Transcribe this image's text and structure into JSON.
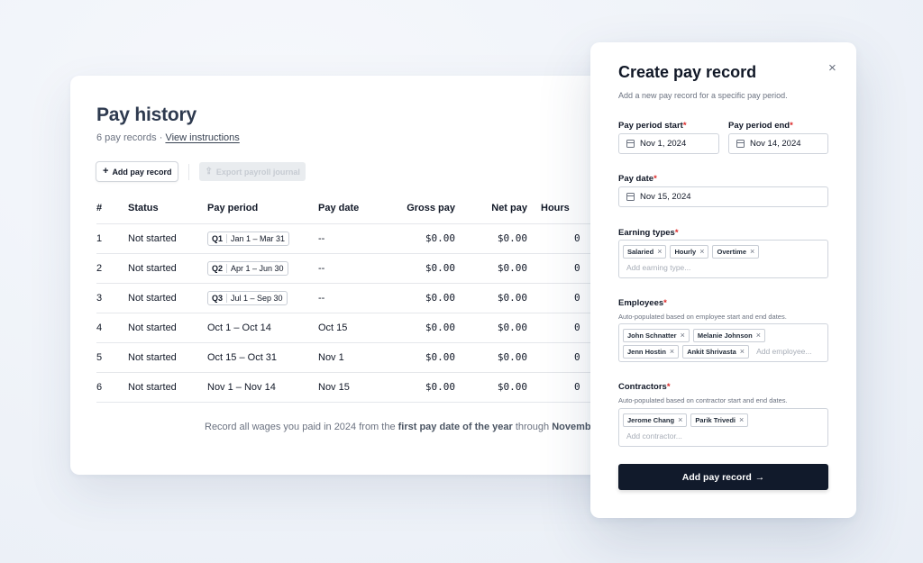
{
  "history": {
    "title": "Pay history",
    "record_count": "6 pay records",
    "separator": "·",
    "instructions_link": "View instructions",
    "add_button": "Add pay record",
    "export_button": "Export payroll journal",
    "columns": [
      "#",
      "Status",
      "Pay period",
      "Pay date",
      "Gross pay",
      "Net pay",
      "Hours"
    ],
    "rows": [
      {
        "num": "1",
        "status": "Not started",
        "quarter": "Q1",
        "period": "Jan 1 – Mar 31",
        "pay_date": "--",
        "gross": "$0.00",
        "net": "$0.00",
        "hours": "0"
      },
      {
        "num": "2",
        "status": "Not started",
        "quarter": "Q2",
        "period": "Apr 1 – Jun 30",
        "pay_date": "--",
        "gross": "$0.00",
        "net": "$0.00",
        "hours": "0"
      },
      {
        "num": "3",
        "status": "Not started",
        "quarter": "Q3",
        "period": "Jul 1 – Sep 30",
        "pay_date": "--",
        "gross": "$0.00",
        "net": "$0.00",
        "hours": "0"
      },
      {
        "num": "4",
        "status": "Not started",
        "quarter": "",
        "period": "Oct 1 – Oct 14",
        "pay_date": "Oct 15",
        "gross": "$0.00",
        "net": "$0.00",
        "hours": "0"
      },
      {
        "num": "5",
        "status": "Not started",
        "quarter": "",
        "period": "Oct 15 – Oct 31",
        "pay_date": "Nov 1",
        "gross": "$0.00",
        "net": "$0.00",
        "hours": "0"
      },
      {
        "num": "6",
        "status": "Not started",
        "quarter": "",
        "period": "Nov 1 – Nov 14",
        "pay_date": "Nov 15",
        "gross": "$0.00",
        "net": "$0.00",
        "hours": "0"
      }
    ],
    "footer": {
      "part1": "Record all wages you paid in 2024 from the ",
      "bold1": "first pay date of the year",
      "part2": " through ",
      "bold2": "November"
    }
  },
  "panel": {
    "title": "Create pay record",
    "close_icon": "×",
    "subtitle": "Add a new pay record for a specific pay period.",
    "required_mark": "*",
    "period_start_label": "Pay period start",
    "period_start_value": "Nov 1, 2024",
    "period_end_label": "Pay period end",
    "period_end_value": "Nov 14, 2024",
    "pay_date_label": "Pay date",
    "pay_date_value": "Nov 15, 2024",
    "earning_types_label": "Earning types",
    "earning_types": [
      "Salaried",
      "Hourly",
      "Overtime"
    ],
    "earning_placeholder": "Add earning type...",
    "employees_label": "Employees",
    "employees_hint": "Auto-populated based on employee start and end dates.",
    "employees_row1": [
      "John Schnatter",
      "Melanie Johnson"
    ],
    "employees_row2": [
      "Jenn Hostin",
      "Ankit Shrivasta"
    ],
    "employees_placeholder": "Add employee...",
    "contractors_label": "Contractors",
    "contractors_hint": "Auto-populated based on contractor start and end dates.",
    "contractors": [
      "Jerome Chang",
      "Parik Trivedi"
    ],
    "contractors_placeholder": "Add contractor...",
    "submit_label": "Add pay record",
    "submit_arrow": "→"
  }
}
